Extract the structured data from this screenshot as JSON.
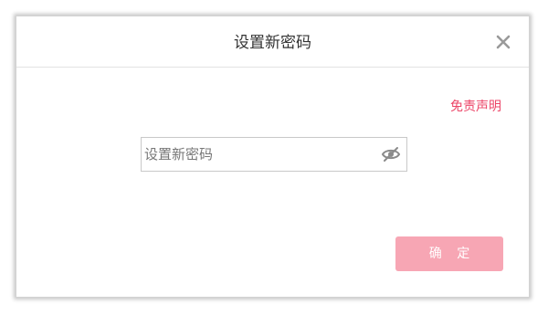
{
  "dialog": {
    "title": "设置新密码",
    "close_icon": "close-icon",
    "disclaimer_label": "免责声明",
    "password_field": {
      "placeholder": "设置新密码",
      "value": "",
      "toggle_icon": "eye-hidden-icon"
    },
    "confirm_label": "确 定"
  },
  "colors": {
    "accent": "#ec4668",
    "confirm_button_bg": "#f7a6b4",
    "title_text": "#333333",
    "placeholder_text": "#777777"
  }
}
